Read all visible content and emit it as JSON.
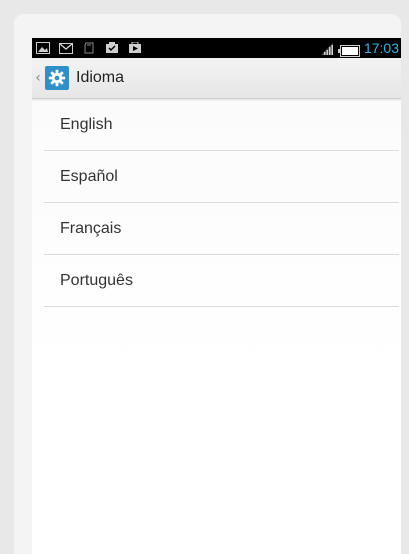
{
  "status_bar": {
    "time": "17:03",
    "icons": [
      "picture-icon",
      "email-icon",
      "sd-card-icon",
      "download-done-icon",
      "play-store-icon"
    ],
    "right_icons": [
      "signal-icon",
      "battery-icon"
    ],
    "clock_color": "#33b5e5"
  },
  "action_bar": {
    "title": "Idioma",
    "icon": "gear-icon",
    "icon_bg": "#2f8fc9"
  },
  "languages": [
    {
      "label": "English"
    },
    {
      "label": "Español"
    },
    {
      "label": "Français"
    },
    {
      "label": "Português"
    }
  ]
}
